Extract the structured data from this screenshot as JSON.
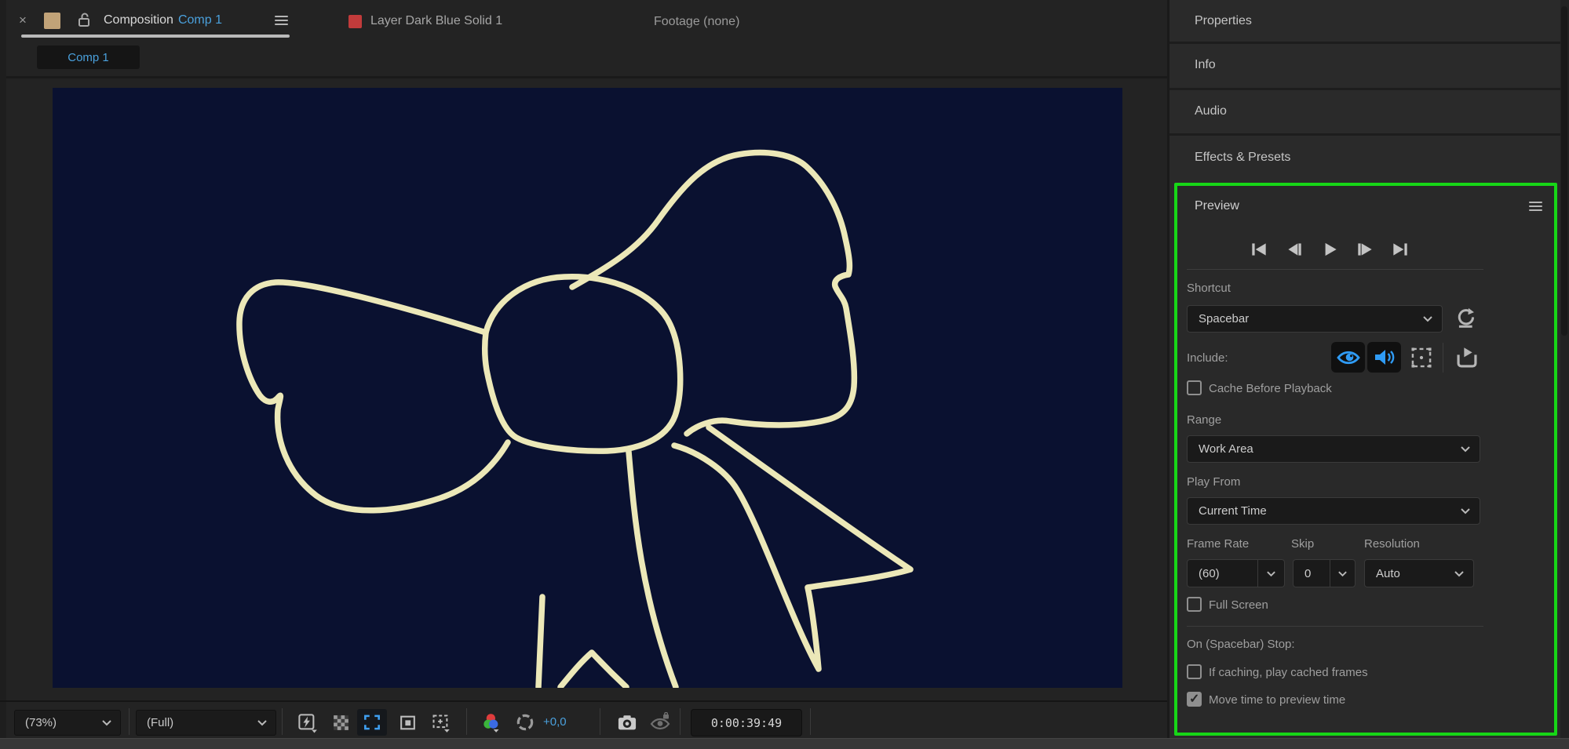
{
  "top_bar": {
    "close_label": "×",
    "composition_label": "Composition",
    "composition_name": "Comp 1",
    "layer_label": "Layer Dark Blue Solid 1",
    "footage_label": "Footage (none)",
    "active_subtab": "Comp 1"
  },
  "toolbar": {
    "zoom_value": "(73%)",
    "resolution_value": "(Full)",
    "exposure_value": "+0,0",
    "timecode": "0:00:39:49"
  },
  "right_panel": {
    "headers": [
      "Properties",
      "Info",
      "Audio",
      "Effects & Presets"
    ]
  },
  "preview": {
    "title": "Preview",
    "shortcut_label": "Shortcut",
    "shortcut_value": "Spacebar",
    "include_label": "Include:",
    "cache_before_playback_label": "Cache Before Playback",
    "cache_before_playback_checked": "false",
    "range_label": "Range",
    "range_value": "Work Area",
    "play_from_label": "Play From",
    "play_from_value": "Current Time",
    "frame_rate_label": "Frame Rate",
    "frame_rate_value": "(60)",
    "skip_label": "Skip",
    "skip_value": "0",
    "resolution_label": "Resolution",
    "resolution_value": "Auto",
    "full_screen_label": "Full Screen",
    "full_screen_checked": "false",
    "on_stop_label": "On (Spacebar) Stop:",
    "if_caching_label": "If caching, play cached frames",
    "if_caching_checked": "false",
    "move_time_label": "Move time to preview time",
    "move_time_checked": "true"
  },
  "colors": {
    "accent_blue": "#4aa0dc",
    "icon_blue": "#2f9bf5",
    "highlight_green": "#17d617",
    "comp_background": "#0a1130",
    "bow_stroke": "#ece8b8",
    "layer_swatch_red": "#c23b3b",
    "comp_swatch_tan": "#c1a378"
  },
  "icons": {
    "close-icon": "×",
    "lock-icon": "open padlock",
    "panel-menu-icon": "≡",
    "go-to-start-icon": "|◀",
    "previous-frame-icon": "◀|",
    "play-icon": "▶",
    "next-frame-icon": "|▶",
    "go-to-end-icon": "▶|",
    "reset-icon": "↺ with underline",
    "video-include-icon": "blue eye",
    "audio-include-icon": "blue speaker",
    "overlays-include-icon": "dashed square with dot",
    "cache-indicators-icon": "tray with play triangle",
    "fast-previews-icon": "lightning in square",
    "transparency-grid-icon": "checkerboard",
    "region-of-interest-icon": "blue corner brackets",
    "mask-visibility-icon": "square in square",
    "grid-guides-icon": "dashed square with triangle",
    "channels-icon": "rgb circles",
    "exposure-icon": "shutter",
    "snapshot-icon": "camera",
    "show-snapshot-icon": "dimmed eye",
    "chevron-down-icon": "⌄"
  }
}
